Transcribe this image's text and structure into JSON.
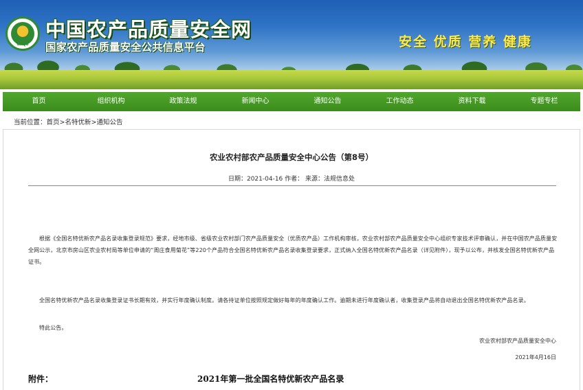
{
  "header": {
    "logo_text": "CAQS",
    "site_title": "中国农产品质量安全网",
    "site_subtitle": "国家农产品质量安全公共信息平台",
    "slogan": "安全 优质 营养 健康",
    "colors": {
      "nav_green": "#3b8c1c",
      "title_shadow": "#174a0f",
      "slogan": "#ffe94d"
    }
  },
  "nav": {
    "items": [
      {
        "label": "首页"
      },
      {
        "label": "组织机构"
      },
      {
        "label": "政策法规"
      },
      {
        "label": "新闻中心"
      },
      {
        "label": "通知公告"
      },
      {
        "label": "工作动态"
      },
      {
        "label": "资料下载"
      },
      {
        "label": "专题专栏"
      }
    ]
  },
  "breadcrumb": {
    "prefix": "当前位置：",
    "items": [
      "首页",
      "名特优新",
      "通知公告"
    ],
    "separator": ">"
  },
  "article": {
    "title": "农业农村部农产品质量安全中心公告（第8号）",
    "meta": "日期：2021-04-16 作者：  来源：法规信息处",
    "paragraphs": [
      "根据《全国名特优新农产品名录收集登录规范》要求，经地市级、省级农业农村部门农产品质量安全（优质农产品）工作机构审核，农业农村部农产品质量安全中心组织专家技术评审确认，并在中国农产品质量安全网公示，北京市房山区农业农村局等单位申请的“周庄食用菊花”等220个产品符合全国名特优新农产品名录收集登录要求，正式纳入全国名特优新农产品名录（详见附件），现予以公布，并核发全国名特优新农产品证书。",
      "全国名特优新农产品名录收集登录证书长期有效，并实行年度确认制度。请各持证单位按照规定做好每年的年度确认工作。逾期未进行年度确认者，收集登录产品将自动退出全国名特优新农产品名录。",
      "特此公告。"
    ],
    "signature_org": "农业农村部农产品质量安全中心",
    "signature_date": "2021年4月16日",
    "attachment_label": "附件：",
    "attachment_title": "2021年第一批全国名特优新农产品名录"
  }
}
